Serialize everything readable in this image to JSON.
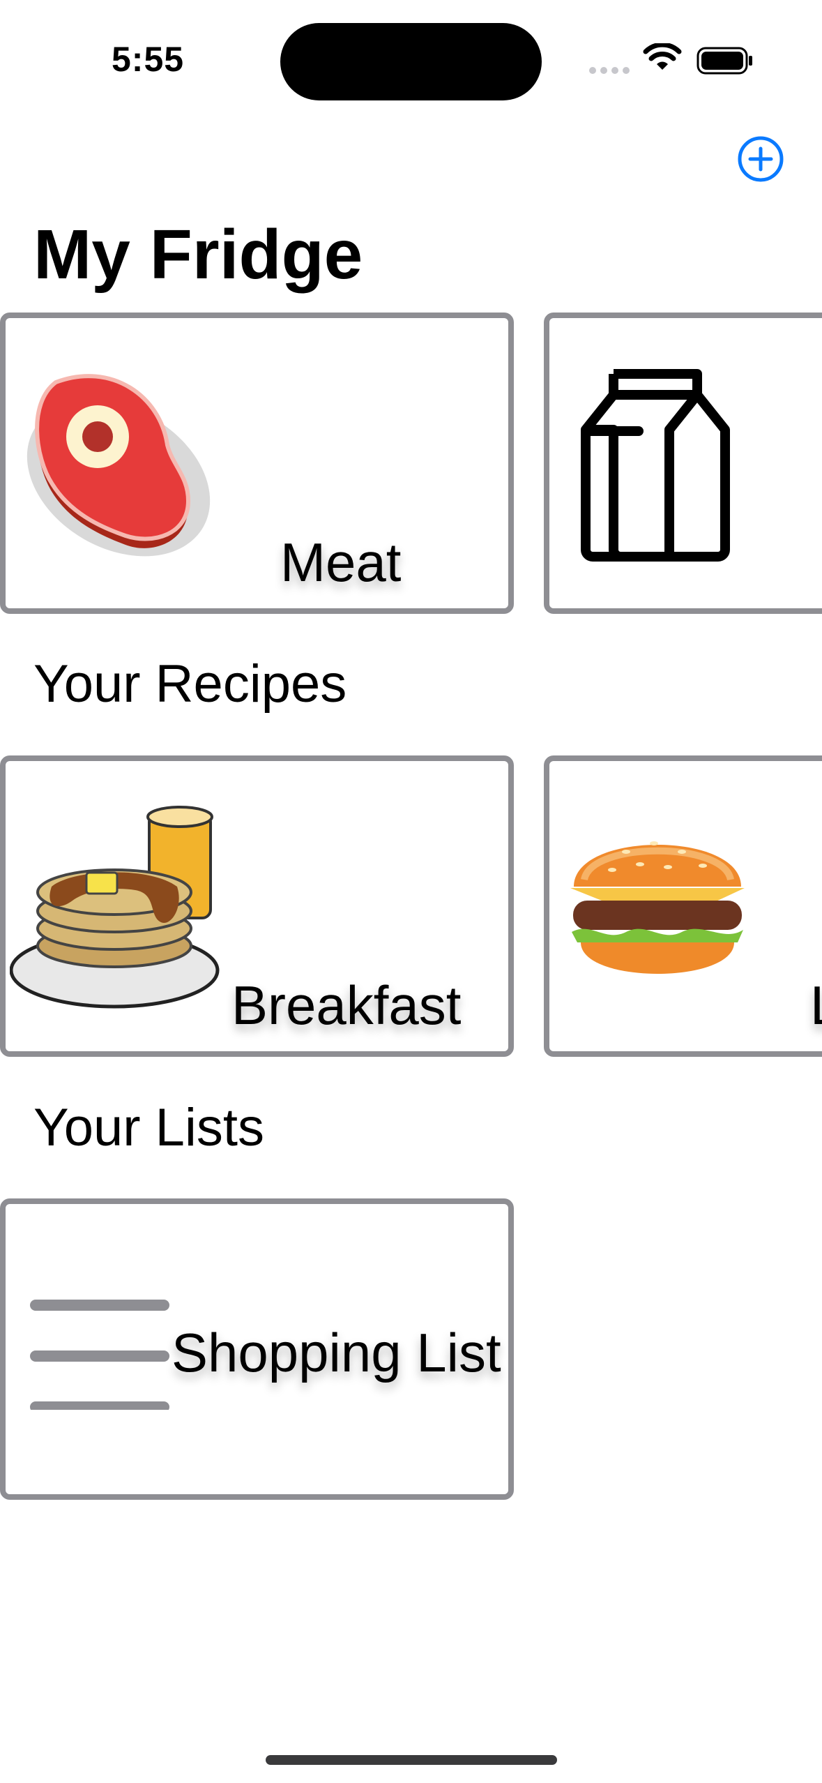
{
  "status_bar": {
    "time": "5:55"
  },
  "nav": {
    "add_icon": "plus-circle-icon",
    "accent": "#0a7aff"
  },
  "title": "My Fridge",
  "fridge": {
    "items": [
      {
        "label": "Meat",
        "icon": "steak-icon"
      },
      {
        "label": "",
        "icon": "milk-carton-icon"
      }
    ]
  },
  "recipes": {
    "title": "Your Recipes",
    "items": [
      {
        "label": "Breakfast",
        "icon": "pancakes-icon"
      },
      {
        "label": "L",
        "icon": "burger-icon"
      }
    ]
  },
  "lists": {
    "title": "Your Lists",
    "items": [
      {
        "label": "Shopping List",
        "icon": "list-icon"
      }
    ]
  },
  "colors": {
    "card_border": "#8e8e93"
  }
}
